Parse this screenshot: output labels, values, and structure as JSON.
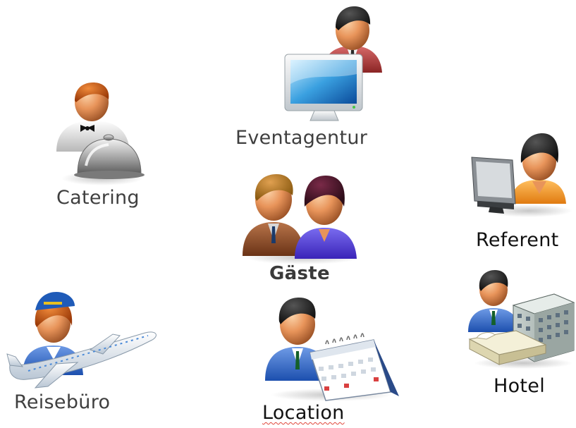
{
  "roles": {
    "eventagentur": "Eventagentur",
    "catering": "Catering",
    "referent": "Referent",
    "gaeste": "Gäste",
    "reisebuero": "Reisebüro",
    "location": "Location",
    "hotel": "Hotel"
  },
  "icons": {
    "eventagentur": "person-with-monitor-icon",
    "catering": "waiter-with-cloche-icon",
    "referent": "person-at-computer-icon",
    "gaeste": "two-guests-icon",
    "reisebuero": "flight-attendant-with-airplane-icon",
    "location": "person-with-calendar-icon",
    "hotel": "person-with-hotel-and-bed-icon"
  },
  "colors": {
    "label_text": "#3f3f3f",
    "skin": "#e8945a",
    "hair": "#1e1a18",
    "spellcheck_underline": "#e0453a"
  }
}
